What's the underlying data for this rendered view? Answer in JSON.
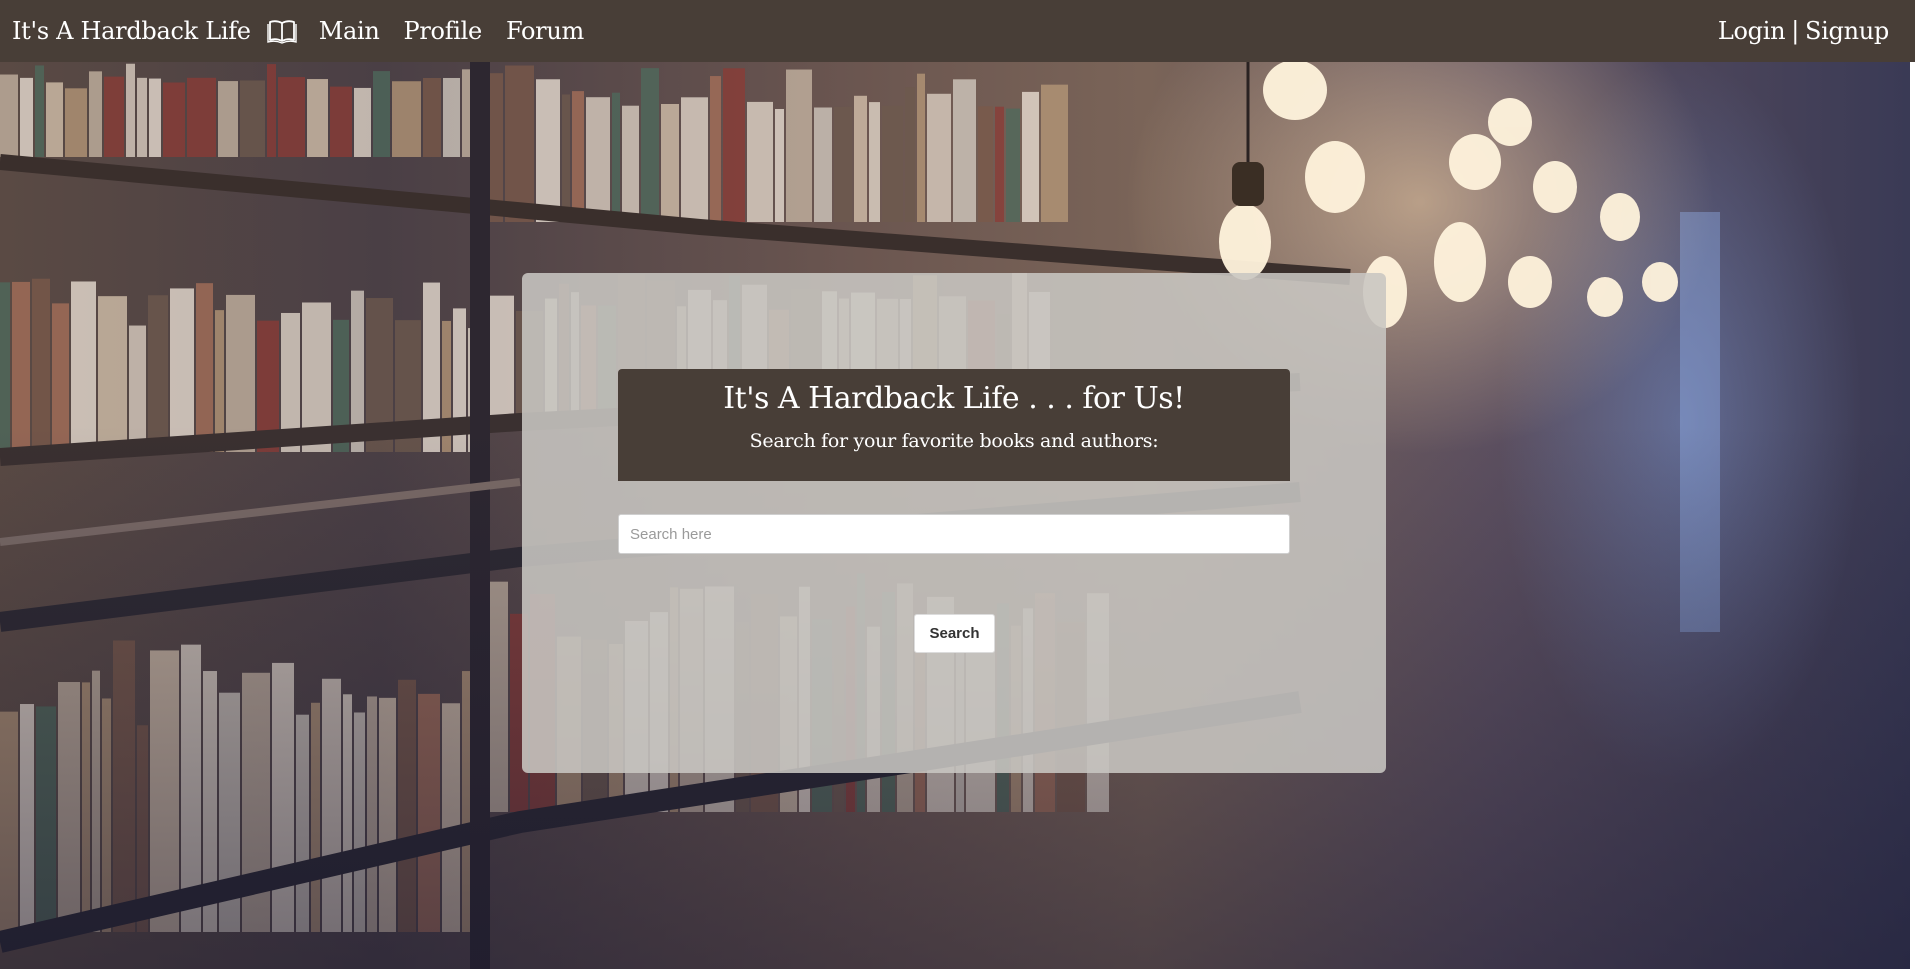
{
  "navbar": {
    "brand": "It's A Hardback Life",
    "brand_icon": "open-book-icon",
    "links": [
      "Main",
      "Profile",
      "Forum"
    ],
    "login_label": "Login",
    "separator": "|",
    "signup_label": "Signup",
    "background_color": "#483e37"
  },
  "hero": {
    "background_description_icon": "library-bookshelves-background"
  },
  "panel": {
    "title": "It's A Hardback Life . . . for Us!",
    "subtitle": "Search for your favorite books and authors:",
    "search_placeholder": "Search here",
    "search_value": "",
    "search_button_label": "Search"
  }
}
